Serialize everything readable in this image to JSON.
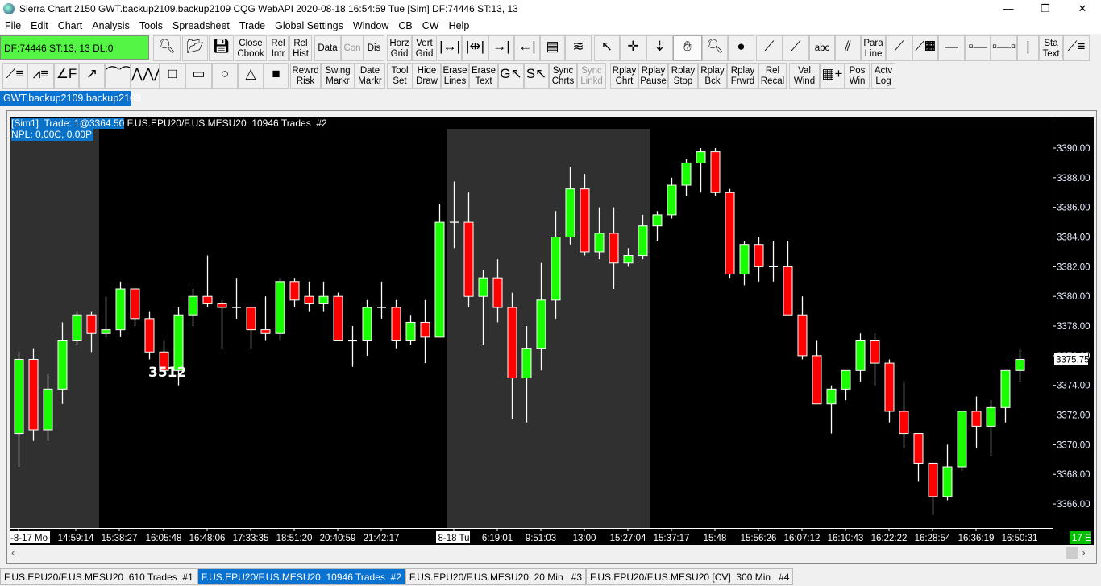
{
  "window": {
    "title": "Sierra Chart 2150 GWT.backup2109.backup2109  CQG WebAPI 2020-08-18  16:54:59 Tue [Sim]  DF:74446  ST:13, 13",
    "minimize": "—",
    "maximize": "❐",
    "close": "✕"
  },
  "menu": [
    "File",
    "Edit",
    "Chart",
    "Analysis",
    "Tools",
    "Spreadsheet",
    "Trade",
    "Global Settings",
    "Window",
    "CB",
    "CW",
    "Help"
  ],
  "status_box": "DF:74446  ST:13, 13  DL:0",
  "toolbar": {
    "row1": [
      {
        "icon": "symbol-search-icon",
        "glyph": "🔍︎"
      },
      {
        "icon": "open-folder-icon",
        "glyph": "📂︎"
      },
      {
        "icon": "save-icon",
        "glyph": "💾︎"
      },
      {
        "l1": "Close",
        "l2": "Cbook"
      },
      {
        "l1": "Rel",
        "l2": "Intr"
      },
      {
        "l1": "Rel",
        "l2": "Hist"
      },
      {
        "l1": "Data"
      },
      {
        "l1": "Con",
        "disabled": true
      },
      {
        "l1": "Dis"
      },
      {
        "l1": "Horz",
        "l2": "Grid"
      },
      {
        "l1": "Vert",
        "l2": "Grid"
      },
      {
        "icon": "expand-space-icon",
        "glyph": "|↔|"
      },
      {
        "icon": "compress-space-icon",
        "glyph": "|⇹|"
      },
      {
        "icon": "shift-right-icon",
        "glyph": "→|←"
      },
      {
        "icon": "shift-left-icon",
        "glyph": "←|→"
      },
      {
        "icon": "chart-settings-icon",
        "glyph": "▤"
      },
      {
        "icon": "studies-icon",
        "glyph": "≋"
      },
      {
        "icon": "pointer-icon",
        "glyph": "↖"
      },
      {
        "icon": "crosshair-icon",
        "glyph": "✛"
      },
      {
        "icon": "values-icon",
        "glyph": "⇣"
      },
      {
        "icon": "hand-pan-icon",
        "glyph": "✋︎",
        "selected": true
      },
      {
        "icon": "zoom-icon",
        "glyph": "🔍︎"
      },
      {
        "icon": "gray-zoom-icon",
        "glyph": "●"
      },
      {
        "icon": "line-icon",
        "glyph": "⟋"
      },
      {
        "icon": "ray-icon",
        "glyph": "⟋"
      },
      {
        "l1": "abc"
      },
      {
        "icon": "parallel-lines-icon",
        "glyph": "⫽"
      },
      {
        "l1": "Para",
        "l2": "Line"
      },
      {
        "icon": "extended-line-icon",
        "glyph": "⟋"
      },
      {
        "icon": "calculator-line-icon",
        "glyph": "⟋▦"
      },
      {
        "icon": "horizontal-line-icon",
        "glyph": "—"
      },
      {
        "icon": "horizontal-ray-icon",
        "glyph": "▫—"
      },
      {
        "icon": "horizontal-segment-icon",
        "glyph": "▫—▫"
      },
      {
        "icon": "vertical-line-icon",
        "glyph": "|"
      },
      {
        "l1": "Sta",
        "l2": "Text"
      },
      {
        "icon": "fib-retracement-icon",
        "glyph": "⟋≡"
      }
    ],
    "row2": [
      {
        "icon": "fib-extension-icon",
        "glyph": "⟋≡"
      },
      {
        "icon": "fib-projection-icon",
        "glyph": "⩘≡"
      },
      {
        "icon": "fan-icon",
        "glyph": "∠F"
      },
      {
        "icon": "arrow-icon",
        "glyph": "↗"
      },
      {
        "icon": "arc-icon",
        "glyph": "⌒⌒"
      },
      {
        "icon": "zigzag-icon",
        "glyph": "⋀⋀⋀"
      },
      {
        "icon": "rectangle-icon",
        "glyph": "□"
      },
      {
        "icon": "wide-rectangle-icon",
        "glyph": "▭"
      },
      {
        "icon": "ellipse-icon",
        "glyph": "○"
      },
      {
        "icon": "triangle-icon",
        "glyph": "△"
      },
      {
        "icon": "marker-icon",
        "glyph": "■"
      },
      {
        "l1": "Rewrd",
        "l2": "Risk"
      },
      {
        "l1": "Swing",
        "l2": "Markr"
      },
      {
        "l1": "Date",
        "l2": "Markr"
      },
      {
        "l1": "Tool",
        "l2": "Set"
      },
      {
        "l1": "Hide",
        "l2": "Draw"
      },
      {
        "l1": "Erase",
        "l2": "Lines"
      },
      {
        "l1": "Erase",
        "l2": "Text"
      },
      {
        "icon": "global-cursor-icon",
        "glyph": "G↖"
      },
      {
        "icon": "snap-cursor-icon",
        "glyph": "S↖"
      },
      {
        "l1": "Sync",
        "l2": "Chrts"
      },
      {
        "l1": "Sync",
        "l2": "Linkd",
        "disabled": true
      },
      {
        "l1": "Rplay",
        "l2": "Chrt"
      },
      {
        "l1": "Rplay",
        "l2": "Pause"
      },
      {
        "l1": "Rplay",
        "l2": "Stop"
      },
      {
        "l1": "Rplay",
        "l2": "Bck"
      },
      {
        "l1": "Rplay",
        "l2": "Frwrd"
      },
      {
        "l1": "Rel",
        "l2": "Recal"
      },
      {
        "l1": "Val",
        "l2": "Wind"
      },
      {
        "icon": "trade-window-icon",
        "glyph": "▦+"
      },
      {
        "l1": "Pos",
        "l2": "Win"
      },
      {
        "l1": "Actv",
        "l2": "Log"
      }
    ]
  },
  "chart_tab": "GWT.backup2109.backup2109",
  "chart_header": {
    "sim": "[Sim1]  Trade: 1@3364.50",
    "symbol": " F.US.EPU20/F.US.MESU20  10946 Trades  #2",
    "npl": "NPL: 0.00C, 0.00P"
  },
  "colors": {
    "up": "#1aff00",
    "down": "#ff0000",
    "background": "#000000",
    "session_shade": "#303030",
    "accent": "#0a73d1",
    "status_green": "#55f545"
  },
  "chart_data": {
    "type": "candlestick",
    "symbol": "F.US.EPU20/F.US.MESU20",
    "ylim": [
      3364.5,
      3391.0
    ],
    "y_ticks": [
      "3390.00",
      "3388.00",
      "3386.00",
      "3384.00",
      "3382.00",
      "3380.00",
      "3378.00",
      "3376.00",
      "3374.00",
      "3372.00",
      "3370.00",
      "3368.00",
      "3366.00"
    ],
    "last_price": "3375.75",
    "bar_annotation": "3512",
    "countdown": "17 E",
    "x_labels": [
      "-8-17 Mo",
      "14:59:14",
      "15:38:27",
      "16:05:48",
      "16:48:06",
      "17:33:35",
      "18:51:20",
      "20:40:59",
      "21:42:17",
      "8-18 Tu",
      "6:19:01",
      "9:51:03",
      "13:00",
      "15:27:04",
      "15:37:17",
      "15:48",
      "15:56:26",
      "16:07:12",
      "16:10:43",
      "16:22:22",
      "16:28:54",
      "16:36:19",
      "16:50:31"
    ],
    "ohlc": [
      [
        3370.75,
        3376.25,
        3368.5,
        3375.75
      ],
      [
        3375.75,
        3376.5,
        3370.25,
        3371
      ],
      [
        3371,
        3374.75,
        3370.25,
        3373.75
      ],
      [
        3373.75,
        3378.25,
        3372.75,
        3377
      ],
      [
        3377,
        3379,
        3376.75,
        3378.75
      ],
      [
        3378.75,
        3379,
        3376.25,
        3377.5
      ],
      [
        3377.5,
        3380,
        3377.25,
        3377.75
      ],
      [
        3377.75,
        3381,
        3377.25,
        3380.5
      ],
      [
        3380.5,
        3380.5,
        3378,
        3378.5
      ],
      [
        3378.5,
        3379,
        3375.75,
        3376.25
      ],
      [
        3376.25,
        3377,
        3375,
        3375
      ],
      [
        3375,
        3379.25,
        3374,
        3378.75
      ],
      [
        3378.75,
        3380.5,
        3378,
        3380
      ],
      [
        3380,
        3382.75,
        3379.25,
        3379.5
      ],
      [
        3379.5,
        3379.75,
        3376.5,
        3379.25
      ],
      [
        3379.25,
        3381.25,
        3378.5,
        3379.25
      ],
      [
        3379.25,
        3379.25,
        3376.5,
        3377.75
      ],
      [
        3377.75,
        3380,
        3377,
        3377.5
      ],
      [
        3377.5,
        3381.25,
        3377,
        3381
      ],
      [
        3381,
        3381.25,
        3379.25,
        3379.75
      ],
      [
        3380,
        3381,
        3379,
        3379.5
      ],
      [
        3379.5,
        3381,
        3379,
        3380
      ],
      [
        3380,
        3380.25,
        3377,
        3377
      ],
      [
        3377,
        3378,
        3375.25,
        3377
      ],
      [
        3377,
        3379.75,
        3376,
        3379.25
      ],
      [
        3379.25,
        3381,
        3378.5,
        3379.25
      ],
      [
        3379.25,
        3379.75,
        3376.5,
        3377
      ],
      [
        3377,
        3378.75,
        3376.75,
        3378.25
      ],
      [
        3378.25,
        3379.75,
        3375.5,
        3377.25
      ],
      [
        3377.25,
        3386.25,
        3377.25,
        3385
      ],
      [
        3385,
        3387.75,
        3383.25,
        3385
      ],
      [
        3385,
        3387,
        3379.25,
        3380
      ],
      [
        3380,
        3381.75,
        3376.75,
        3381.25
      ],
      [
        3381.25,
        3382.5,
        3378.25,
        3379.25
      ],
      [
        3379.25,
        3380.25,
        3371.75,
        3374.5
      ],
      [
        3374.5,
        3378,
        3371.5,
        3376.5
      ],
      [
        3376.5,
        3382.25,
        3375,
        3379.75
      ],
      [
        3379.75,
        3385.75,
        3378.5,
        3384
      ],
      [
        3384,
        3388.75,
        3383.5,
        3387.25
      ],
      [
        3387.25,
        3388.25,
        3382.75,
        3383
      ],
      [
        3383,
        3386,
        3382.5,
        3384.25
      ],
      [
        3384.25,
        3386,
        3380.5,
        3382.25
      ],
      [
        3382.25,
        3383.25,
        3382,
        3382.75
      ],
      [
        3382.75,
        3385.5,
        3382.5,
        3384.75
      ],
      [
        3384.75,
        3385.75,
        3383.75,
        3385.5
      ],
      [
        3385.5,
        3388,
        3385.25,
        3387.5
      ],
      [
        3387.5,
        3389.25,
        3386.75,
        3389
      ],
      [
        3389,
        3390,
        3387,
        3389.75
      ],
      [
        3389.75,
        3390,
        3386.75,
        3387
      ],
      [
        3387,
        3387.25,
        3381.25,
        3381.5
      ],
      [
        3381.5,
        3383.75,
        3380.75,
        3383.5
      ],
      [
        3383.5,
        3384,
        3381,
        3382
      ],
      [
        3382,
        3383.75,
        3381,
        3382
      ],
      [
        3382,
        3383.75,
        3378.75,
        3378.75
      ],
      [
        3378.75,
        3380,
        3375.75,
        3376
      ],
      [
        3376,
        3377,
        3372.75,
        3372.75
      ],
      [
        3372.75,
        3374,
        3370.75,
        3373.75
      ],
      [
        3373.75,
        3375,
        3373,
        3375
      ],
      [
        3375,
        3377.5,
        3374.25,
        3377
      ],
      [
        3377,
        3377.5,
        3374,
        3375.5
      ],
      [
        3375.5,
        3375.75,
        3371.5,
        3372.25
      ],
      [
        3372.25,
        3374.25,
        3369.75,
        3370.75
      ],
      [
        3370.75,
        3370.75,
        3367.5,
        3368.75
      ],
      [
        3368.75,
        3368.75,
        3365.25,
        3366.5
      ],
      [
        3366.5,
        3370,
        3366.25,
        3368.5
      ],
      [
        3368.5,
        3372.25,
        3368.25,
        3372.25
      ],
      [
        3372.25,
        3373.25,
        3369.75,
        3371.25
      ],
      [
        3371.25,
        3373,
        3369.25,
        3372.5
      ],
      [
        3372.5,
        3375,
        3371.5,
        3375
      ],
      [
        3375,
        3376.5,
        3374.25,
        3375.75
      ]
    ]
  },
  "bottom_tabs": [
    {
      "label": "F.US.EPU20/F.US.MESU20  610 Trades  #1"
    },
    {
      "label": "F.US.EPU20/F.US.MESU20  10946 Trades  #2",
      "active": true
    },
    {
      "label": "F.US.EPU20/F.US.MESU20  20 Min   #3"
    },
    {
      "label": "F.US.EPU20/F.US.MESU20 [CV]  300 Min   #4"
    }
  ],
  "scrollbar": {
    "left": "‹",
    "right": "›"
  }
}
